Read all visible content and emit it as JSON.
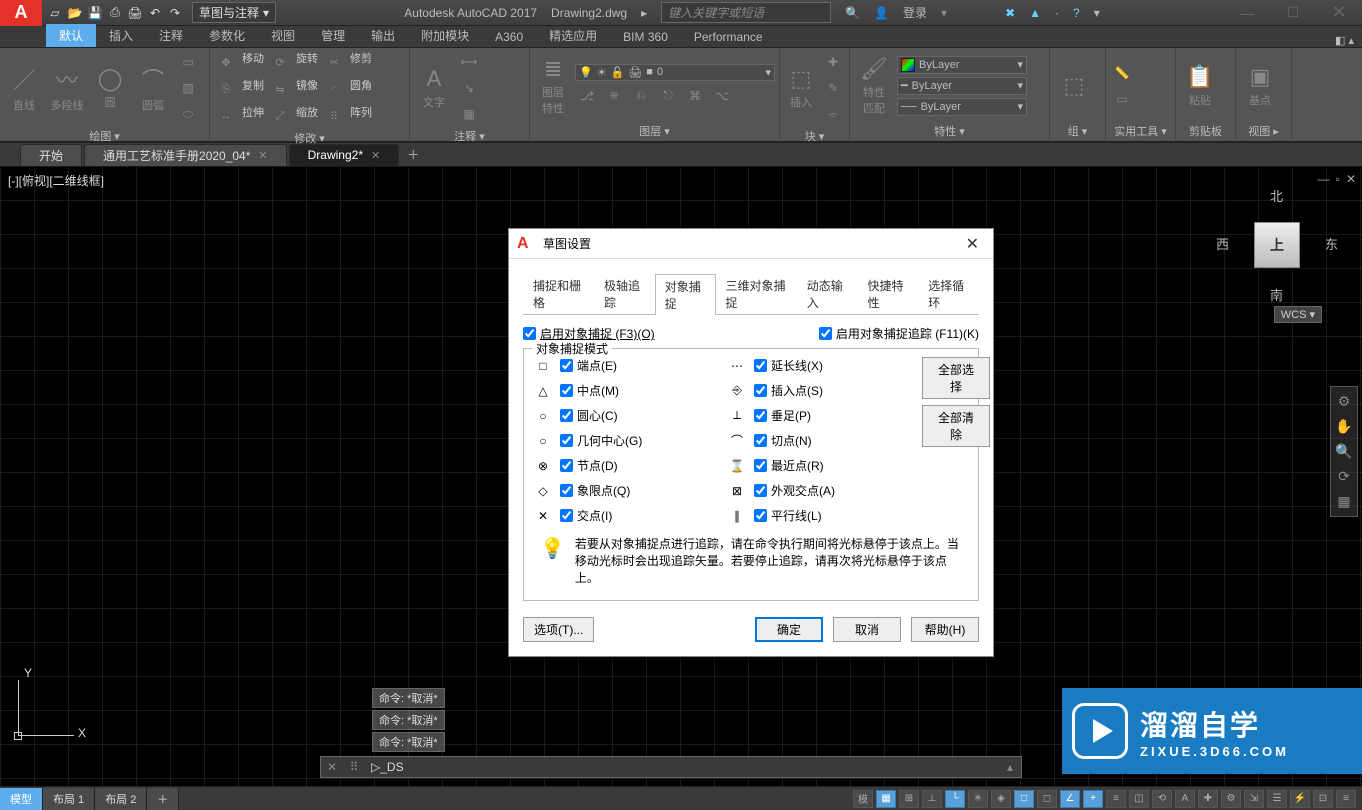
{
  "title": {
    "app": "Autodesk AutoCAD 2017",
    "file": "Drawing2.dwg",
    "combo": "草图与注释",
    "search_placeholder": "键入关键字或短语",
    "login": "登录"
  },
  "ribbon_tabs": [
    "默认",
    "插入",
    "注释",
    "参数化",
    "视图",
    "管理",
    "输出",
    "附加模块",
    "A360",
    "精选应用",
    "BIM 360",
    "Performance"
  ],
  "panels": {
    "draw": {
      "label": "绘图 ▾",
      "line": "直线",
      "polyline": "多段线",
      "circle": "圆",
      "arc": "圆弧"
    },
    "modify": {
      "label": "修改 ▾",
      "move": "移动",
      "rotate": "旋转",
      "trim": "修剪",
      "copy": "复制",
      "mirror": "镜像",
      "fillet": "圆角",
      "stretch": "拉伸",
      "scale": "缩放",
      "array": "阵列"
    },
    "annot": {
      "label": "注释 ▾",
      "text": "文字"
    },
    "layer": {
      "label": "图层 ▾",
      "big": "图层\n特性",
      "current": "0"
    },
    "block": {
      "label": "块 ▾",
      "insert": "插入"
    },
    "prop": {
      "label": "特性 ▾",
      "big": "特性\n匹配",
      "bylayer": "ByLayer"
    },
    "group": {
      "label": "组 ▾"
    },
    "util": {
      "label": "实用工具 ▾"
    },
    "clip": {
      "label": "剪贴板",
      "paste": "粘贴"
    },
    "view": {
      "label": "视图 ▸",
      "base": "基点"
    }
  },
  "doc_tabs": {
    "start": "开始",
    "t1": "通用工艺标准手册2020_04*",
    "t2": "Drawing2*"
  },
  "drawing": {
    "viewlabel": "[-][俯视][二维线框]",
    "cube": {
      "top": "北",
      "right": "东",
      "bottom": "南",
      "left": "西",
      "face": "上"
    },
    "wcs": "WCS  ▾",
    "cmdhistory": [
      "命令: *取消*",
      "命令: *取消*",
      "命令: *取消*"
    ],
    "cmd_prefix": "▷_",
    "cmd_text": "DS"
  },
  "status": {
    "layouts": [
      "模型",
      "布局 1",
      "布局 2"
    ]
  },
  "dialog": {
    "title": "草图设置",
    "tabs": [
      "捕捉和栅格",
      "极轴追踪",
      "对象捕捉",
      "三维对象捕捉",
      "动态输入",
      "快捷特性",
      "选择循环"
    ],
    "enable_osnap": "启用对象捕捉 (F3)(O)",
    "enable_track": "启用对象捕捉追踪 (F11)(K)",
    "group_legend": "对象捕捉模式",
    "left": [
      {
        "sym": "□",
        "label": "端点(E)",
        "chk": true
      },
      {
        "sym": "△",
        "label": "中点(M)",
        "chk": true
      },
      {
        "sym": "○",
        "label": "圆心(C)",
        "chk": true
      },
      {
        "sym": "○",
        "label": "几何中心(G)",
        "chk": true
      },
      {
        "sym": "⊗",
        "label": "节点(D)",
        "chk": true
      },
      {
        "sym": "◇",
        "label": "象限点(Q)",
        "chk": true
      },
      {
        "sym": "✕",
        "label": "交点(I)",
        "chk": true
      }
    ],
    "right": [
      {
        "sym": "⋯",
        "label": "延长线(X)",
        "chk": true
      },
      {
        "sym": "⎆",
        "label": "插入点(S)",
        "chk": true
      },
      {
        "sym": "⟂",
        "label": "垂足(P)",
        "chk": true
      },
      {
        "sym": "⌒",
        "label": "切点(N)",
        "chk": true
      },
      {
        "sym": "⌛",
        "label": "最近点(R)",
        "chk": true
      },
      {
        "sym": "⊠",
        "label": "外观交点(A)",
        "chk": true
      },
      {
        "sym": "∥",
        "label": "平行线(L)",
        "chk": true
      }
    ],
    "select_all": "全部选择",
    "clear_all": "全部清除",
    "tip": "若要从对象捕捉点进行追踪，请在命令执行期间将光标悬停于该点上。当移动光标时会出现追踪矢量。若要停止追踪，请再次将光标悬停于该点上。",
    "options": "选项(T)...",
    "ok": "确定",
    "cancel": "取消",
    "help": "帮助(H)"
  },
  "watermark": {
    "big": "溜溜自学",
    "small": "ZIXUE.3D66.COM"
  }
}
